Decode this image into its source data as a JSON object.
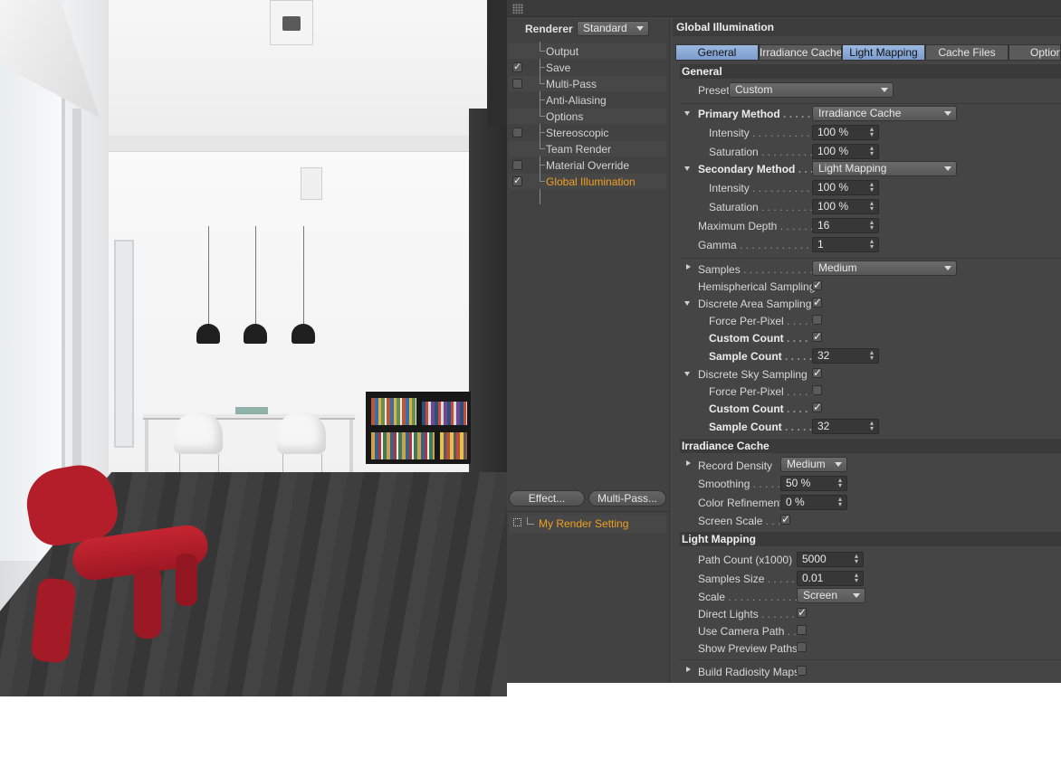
{
  "renderer": {
    "label": "Renderer",
    "value": "Standard"
  },
  "tree": [
    {
      "label": "Output",
      "check": "",
      "active": false
    },
    {
      "label": "Save",
      "check": "✓",
      "active": false
    },
    {
      "label": "Multi-Pass",
      "check": "",
      "active": false
    },
    {
      "label": "Anti-Aliasing",
      "check": null,
      "active": false
    },
    {
      "label": "Options",
      "check": null,
      "active": false
    },
    {
      "label": "Stereoscopic",
      "check": "",
      "active": false
    },
    {
      "label": "Team Render",
      "check": null,
      "active": false
    },
    {
      "label": "Material Override",
      "check": "",
      "active": false
    },
    {
      "label": "Global Illumination",
      "check": "✓",
      "active": true
    }
  ],
  "buttons": {
    "effect": "Effect...",
    "multipass": "Multi-Pass..."
  },
  "render_setting": "My Render Setting",
  "gi": {
    "title": "Global Illumination",
    "tabs": [
      "General",
      "Irradiance Cache",
      "Light Mapping",
      "Cache Files",
      "Options"
    ],
    "general": {
      "header": "General",
      "preset_label": "Preset",
      "preset_value": "Custom",
      "primary_method_label": "Primary Method",
      "primary_method_value": "Irradiance Cache",
      "intensity_label": "Intensity",
      "saturation_label": "Saturation",
      "primary_intensity": "100 %",
      "primary_saturation": "100 %",
      "secondary_method_label": "Secondary Method",
      "secondary_method_value": "Light Mapping",
      "secondary_intensity": "100 %",
      "secondary_saturation": "100 %",
      "max_depth_label": "Maximum Depth",
      "max_depth_value": "16",
      "gamma_label": "Gamma",
      "gamma_value": "1",
      "samples_label": "Samples",
      "samples_value": "Medium",
      "hemispherical_label": "Hemispherical Sampling",
      "discrete_area_label": "Discrete Area Sampling",
      "force_per_pixel_label": "Force Per-Pixel",
      "custom_count_label": "Custom Count",
      "sample_count_label": "Sample Count",
      "area_sample_count": "32",
      "discrete_sky_label": "Discrete Sky Sampling",
      "sky_sample_count": "32"
    },
    "irradiance": {
      "header": "Irradiance Cache",
      "record_density_label": "Record Density",
      "record_density_value": "Medium",
      "smoothing_label": "Smoothing",
      "smoothing_value": "50 %",
      "color_refinement_label": "Color Refinement",
      "color_refinement_value": "0 %",
      "screen_scale_label": "Screen Scale"
    },
    "light_mapping": {
      "header": "Light Mapping",
      "path_count_label": "Path Count (x1000)",
      "path_count_value": "5000",
      "samples_size_label": "Samples Size",
      "samples_size_value": "0.01",
      "scale_label": "Scale",
      "scale_value": "Screen",
      "direct_lights_label": "Direct Lights",
      "use_camera_path_label": "Use Camera Path",
      "show_preview_paths_label": "Show Preview Paths"
    },
    "build_radiosity_label": "Build Radiosity Maps"
  },
  "colors": {
    "panel_bg": "#454545",
    "active_orange": "#f0a020",
    "tab_highlight": "#8aa9d6",
    "chair_red": "#b41e2a"
  }
}
